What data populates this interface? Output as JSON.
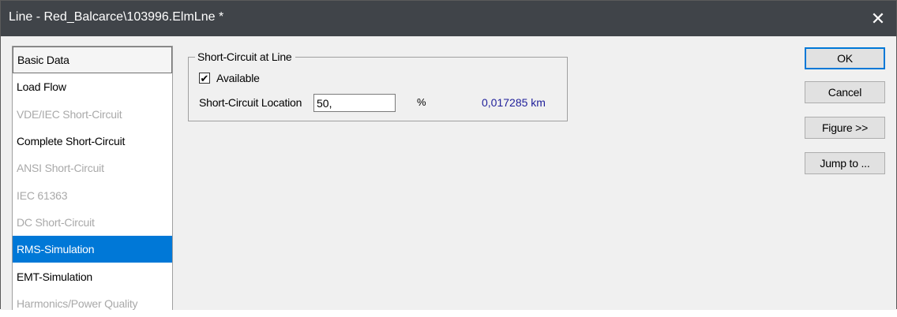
{
  "window": {
    "title": "Line - Red_Balcarce\\103996.ElmLne *",
    "close_glyph": "✕"
  },
  "nav": {
    "items": [
      {
        "label": "Basic Data",
        "state": "focused"
      },
      {
        "label": "Load Flow",
        "state": "enabled"
      },
      {
        "label": "VDE/IEC Short-Circuit",
        "state": "disabled"
      },
      {
        "label": "Complete Short-Circuit",
        "state": "enabled"
      },
      {
        "label": "ANSI Short-Circuit",
        "state": "disabled"
      },
      {
        "label": "IEC 61363",
        "state": "disabled"
      },
      {
        "label": "DC Short-Circuit",
        "state": "disabled"
      },
      {
        "label": "RMS-Simulation",
        "state": "selected"
      },
      {
        "label": "EMT-Simulation",
        "state": "enabled"
      },
      {
        "label": "Harmonics/Power Quality",
        "state": "disabled"
      }
    ]
  },
  "short_circuit": {
    "group_title": "Short-Circuit at Line",
    "available_label": "Available",
    "available_checked": true,
    "check_glyph": "✔",
    "location_label": "Short-Circuit Location",
    "location_value": "50,",
    "location_unit": "%",
    "location_km": "0,017285 km"
  },
  "buttons": {
    "ok": "OK",
    "cancel": "Cancel",
    "figure": "Figure >>",
    "jump": "Jump to ..."
  },
  "colors": {
    "titlebar": "#404449",
    "selection": "#0078d7",
    "disabled_text": "#a9a9a9",
    "km_value": "#1f1f9a"
  }
}
